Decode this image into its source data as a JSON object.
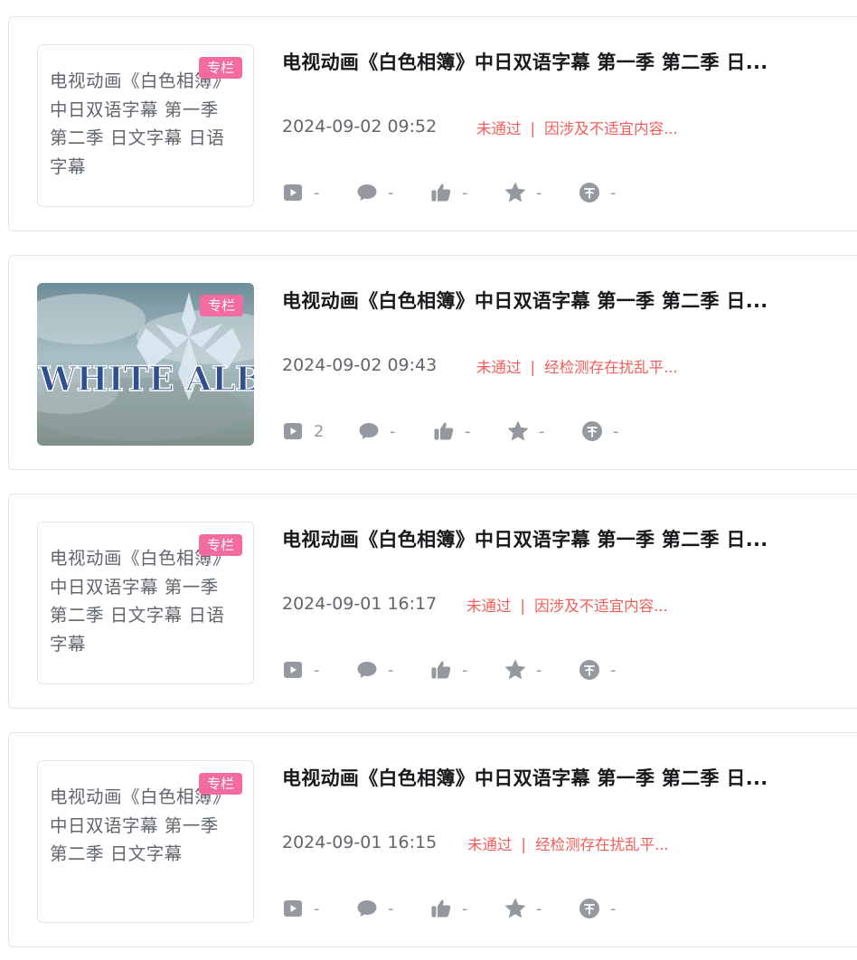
{
  "items": [
    {
      "cover_text": "电视动画《白色相簿》中日双语字幕 第一季 第二季 日文字幕 日语字幕",
      "tag": "专栏",
      "title": "电视动画《白色相簿》中日双语字幕 第一季 第二季 日...",
      "date": "2024-09-02 09:52",
      "status_label": "未通过",
      "status_sep": "|",
      "status_reason": "因涉及不适宜内容...",
      "stats": {
        "plays": "-",
        "comments": "-",
        "likes": "-",
        "favorites": "-",
        "coins": "-"
      }
    },
    {
      "cover_image": "WHITE ALBUM",
      "tag": "专栏",
      "title": "电视动画《白色相簿》中日双语字幕 第一季 第二季 日...",
      "date": "2024-09-02 09:43",
      "status_label": "未通过",
      "status_sep": "|",
      "status_reason": "经检测存在扰乱平...",
      "stats": {
        "plays": "2",
        "comments": "-",
        "likes": "-",
        "favorites": "-",
        "coins": "-"
      }
    },
    {
      "cover_text": "电视动画《白色相簿》中日双语字幕 第一季 第二季 日文字幕 日语字幕",
      "tag": "专栏",
      "title": "电视动画《白色相簿》中日双语字幕 第一季 第二季 日...",
      "date": "2024-09-01 16:17",
      "status_label": "未通过",
      "status_sep": "|",
      "status_reason": "因涉及不适宜内容...",
      "stats": {
        "plays": "-",
        "comments": "-",
        "likes": "-",
        "favorites": "-",
        "coins": "-"
      }
    },
    {
      "cover_text": "电视动画《白色相簿》中日双语字幕 第一季 第二季 日文字幕",
      "tag": "专栏",
      "title": "电视动画《白色相簿》中日双语字幕 第一季 第二季 日...",
      "date": "2024-09-01 16:15",
      "status_label": "未通过",
      "status_sep": "|",
      "status_reason": "经检测存在扰乱平...",
      "stats": {
        "plays": "-",
        "comments": "-",
        "likes": "-",
        "favorites": "-",
        "coins": "-"
      }
    }
  ],
  "icons": [
    "play-icon",
    "comment-icon",
    "like-icon",
    "favorite-icon",
    "coin-icon"
  ],
  "colors": {
    "tag": "#f36ba0",
    "status": "#f25d59",
    "icon": "#9499a0",
    "text_secondary": "#61666d"
  }
}
